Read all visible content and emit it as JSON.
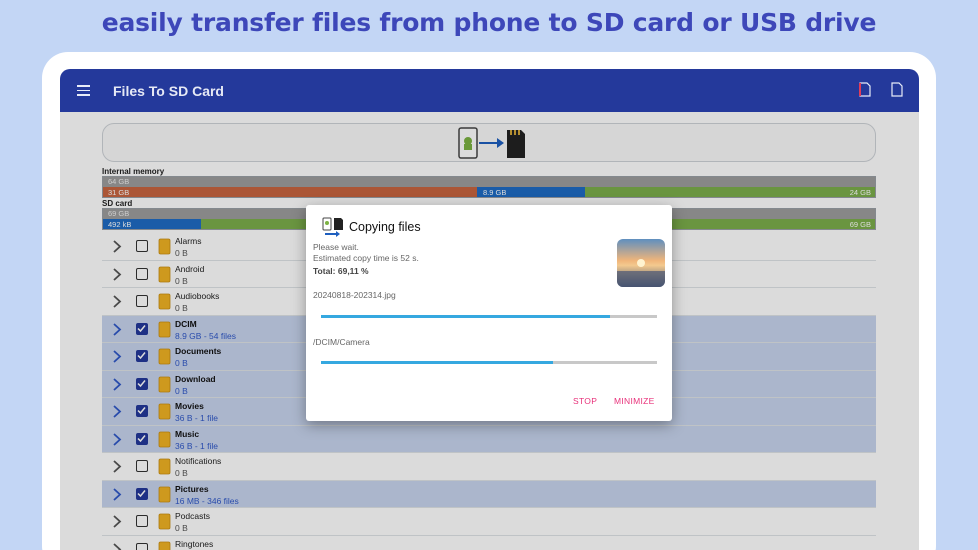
{
  "headline": "easily transfer files from phone to SD card or USB drive",
  "appbar": {
    "title": "Files To SD Card"
  },
  "storage": {
    "internal": {
      "label": "Internal memory",
      "total": "64 GB",
      "seg1": "31 GB",
      "seg2": "8.9 GB",
      "seg3": "24 GB"
    },
    "sdcard": {
      "label": "SD card",
      "total": "69 GB",
      "seg1": "492 kB",
      "seg2": "69 GB"
    }
  },
  "folders": [
    {
      "name": "Alarms",
      "size": "0 B",
      "checked": false
    },
    {
      "name": "Android",
      "size": "0 B",
      "checked": false
    },
    {
      "name": "Audiobooks",
      "size": "0 B",
      "checked": false
    },
    {
      "name": "DCIM",
      "size": "8.9 GB - 54 files",
      "checked": true
    },
    {
      "name": "Documents",
      "size": "0 B",
      "checked": true
    },
    {
      "name": "Download",
      "size": "0 B",
      "checked": true
    },
    {
      "name": "Movies",
      "size": "36 B - 1 file",
      "checked": true
    },
    {
      "name": "Music",
      "size": "36 B - 1 file",
      "checked": true
    },
    {
      "name": "Notifications",
      "size": "0 B",
      "checked": false
    },
    {
      "name": "Pictures",
      "size": "16 MB - 346 files",
      "checked": true
    },
    {
      "name": "Podcasts",
      "size": "0 B",
      "checked": false
    },
    {
      "name": "Ringtones",
      "size": "",
      "checked": false
    }
  ],
  "dialog": {
    "title": "Copying files",
    "wait": "Please wait.",
    "estimate": "Estimated copy time is 52 s.",
    "total": "Total: 69,11 %",
    "current_file": "20240818-202314.jpg",
    "file_progress": 0.86,
    "current_folder": "/DCIM/Camera",
    "folder_progress": 0.69,
    "stop_label": "STOP",
    "minimize_label": "MINIMIZE"
  },
  "colors": {
    "appbar": "#24399b",
    "headline": "#3d47b9",
    "accent": "#e8317a",
    "progress": "#35a8e0"
  }
}
